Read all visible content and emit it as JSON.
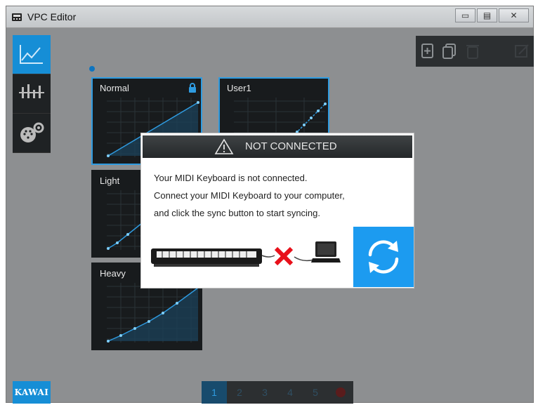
{
  "window": {
    "title": "VPC Editor",
    "controls": [
      "minimize",
      "maximize",
      "close"
    ]
  },
  "sidebar": {
    "items": [
      {
        "name": "touch-curve",
        "icon": "chart-line-icon",
        "active": true
      },
      {
        "name": "voicing",
        "icon": "sliders-icon",
        "active": false
      },
      {
        "name": "midi-settings",
        "icon": "midi-gear-icon",
        "active": false
      }
    ],
    "brand": "KAWAI"
  },
  "toolbar": {
    "icons": [
      "new-file-icon",
      "copy-icon",
      "delete-icon",
      "edit-icon"
    ]
  },
  "curves": [
    {
      "label": "Normal",
      "locked": true,
      "selected": true
    },
    {
      "label": "User1",
      "locked": false,
      "selected": true
    },
    {
      "label": "Light",
      "locked": false,
      "selected": false
    },
    {
      "label": "Heavy",
      "locked": false,
      "selected": false
    }
  ],
  "pager": {
    "pages": [
      "1",
      "2",
      "3",
      "4",
      "5"
    ],
    "active": "1"
  },
  "dialog": {
    "title": "NOT CONNECTED",
    "line1": "Your MIDI Keyboard is not connected.",
    "line2": "Connect your MIDI Keyboard to your computer,",
    "line3": "and click the sync button to start syncing.",
    "sync_icon": "sync-icon"
  },
  "colors": {
    "accent": "#168ed6",
    "sync": "#1c9bf0",
    "error": "#e8101a"
  }
}
